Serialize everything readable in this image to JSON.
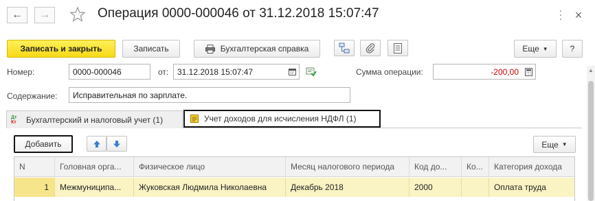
{
  "window": {
    "title": "Операция 0000-000046 от 31.12.2018 15:07:47"
  },
  "toolbar": {
    "save_close_label": "Записать и закрыть",
    "save_label": "Записать",
    "accounting_ref_label": "Бухгалтерская справка",
    "more_label": "Еще",
    "help_label": "?"
  },
  "form": {
    "number_label": "Номер:",
    "number_value": "0000-000046",
    "date_label": "от:",
    "date_value": "31.12.2018 15:07:47",
    "sum_label": "Сумма операции:",
    "sum_value": "-200,00",
    "content_label": "Содержание:",
    "content_value": "Исправительная по зарплате."
  },
  "tabs": [
    {
      "label": "Бухгалтерский и налоговый учет (1)",
      "icon_text": "Дт Кт"
    },
    {
      "label": "Учет доходов для исчисления НДФЛ (1)"
    }
  ],
  "table_toolbar": {
    "add_label": "Добавить",
    "more_label": "Еще"
  },
  "table": {
    "columns": [
      "N",
      "Головная орга...",
      "Физическое лицо",
      "Месяц налогового периода",
      "Код до...",
      "Ко...",
      "Категория дохода"
    ],
    "rows": [
      [
        "1",
        "Межмуниципа...",
        "Жуковская Людмила Николаевна",
        "Декабрь 2018",
        "2000",
        "",
        "Оплата труда"
      ]
    ]
  },
  "colors": {
    "primary_button": "#f6d917",
    "negative_amount": "#cc0000",
    "selected_row": "#faf3c4",
    "arrow_blue": "#3a7fd0"
  }
}
